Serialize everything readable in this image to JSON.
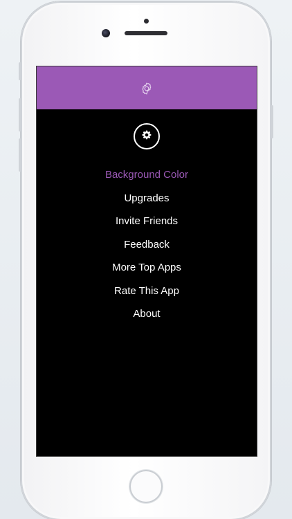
{
  "app": {
    "accent_color": "#9b59b6",
    "background_color": "#000000"
  },
  "nav_bar": {
    "icon": "gear-icon"
  },
  "profile": {
    "icon": "gear-icon"
  },
  "menu": {
    "items": [
      {
        "label": "Background Color",
        "active": true
      },
      {
        "label": "Upgrades",
        "active": false
      },
      {
        "label": "Invite Friends",
        "active": false
      },
      {
        "label": "Feedback",
        "active": false
      },
      {
        "label": "More Top Apps",
        "active": false
      },
      {
        "label": "Rate This App",
        "active": false
      },
      {
        "label": "About",
        "active": false
      }
    ]
  }
}
